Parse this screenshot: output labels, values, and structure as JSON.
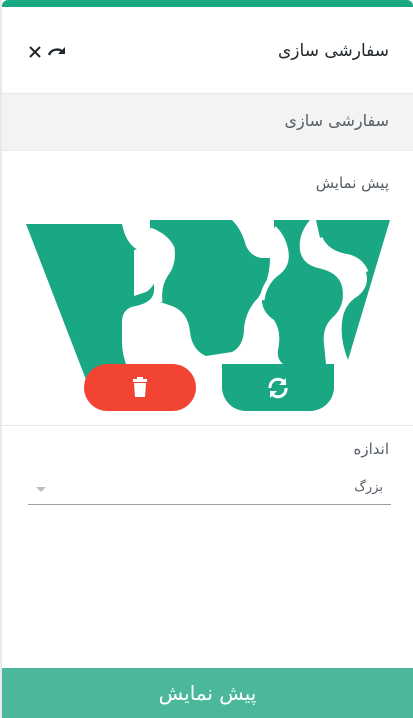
{
  "header": {
    "title": "سفارشی سازی",
    "icons": [
      "close-icon",
      "redo-icon"
    ]
  },
  "section": {
    "title": "سفارشی سازی"
  },
  "preview": {
    "label": "پیش نمایش"
  },
  "actions": {
    "delete_icon": "trash-icon",
    "refresh_icon": "refresh-icon"
  },
  "size": {
    "label": "اندازه",
    "selected": "بزرگ"
  },
  "footer": {
    "button_label": "پیش نمایش"
  },
  "colors": {
    "accent": "#1aa783",
    "danger": "#f24433",
    "footer": "#4bb89b"
  }
}
